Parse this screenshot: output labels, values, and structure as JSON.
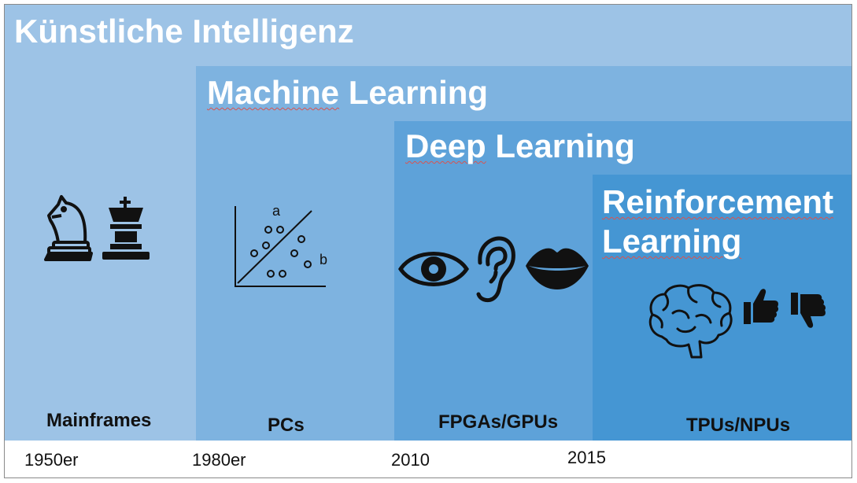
{
  "layers": {
    "ki": {
      "title": "Künstliche Intelligenz",
      "color": "#9dc3e6"
    },
    "ml": {
      "title_part1": "Machine",
      "title_part2": " Learning",
      "color": "#7eb3e0"
    },
    "dl": {
      "title_part1": "Deep",
      "title_part2": " Learning",
      "color": "#5ea2d9"
    },
    "rl": {
      "title_line1": "Reinforcement",
      "title_line2": "Learning",
      "color": "#4596d3"
    }
  },
  "hardware": {
    "ki": "Mainframes",
    "ml": "PCs",
    "dl": "FPGAs/GPUs",
    "rl": "TPUs/NPUs"
  },
  "timeline": {
    "y1": "1950er",
    "y2": "1980er",
    "y3": "2010",
    "y4": "2015"
  },
  "scatter": {
    "label_a": "a",
    "label_b": "b"
  },
  "icons": [
    "chess-knight-icon",
    "chess-king-icon",
    "scatter-plot-icon",
    "eye-icon",
    "ear-icon",
    "lips-icon",
    "brain-icon",
    "thumbs-up-icon",
    "thumbs-down-icon"
  ]
}
